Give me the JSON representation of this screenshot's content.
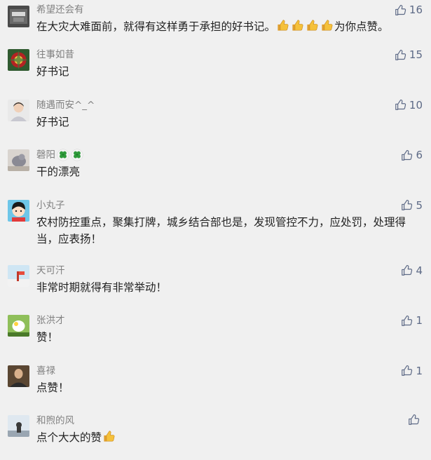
{
  "comments": [
    {
      "name": "希望还会有",
      "text": "在大灾大难面前，就得有这样勇于承担的好书记。",
      "text_suffix": "为你点赞。",
      "likes": "16",
      "thumbs": 4
    },
    {
      "name": "往事如昔",
      "text": "好书记",
      "likes": "15"
    },
    {
      "name": "随遇而安^_^",
      "text": "好书记",
      "likes": "10"
    },
    {
      "name": "磬阳",
      "text": "干的漂亮",
      "likes": "6"
    },
    {
      "name": "小丸子",
      "text": "农村防控重点，聚集打牌，城乡结合部也是，发现管控不力，应处罚，处理得当，应表扬！",
      "likes": "5"
    },
    {
      "name": "天可汗",
      "text": "非常时期就得有非常举动！",
      "likes": "4"
    },
    {
      "name": "张洪才",
      "text": "赞！",
      "likes": "1"
    },
    {
      "name": "喜禄",
      "text": "点赞！",
      "likes": "1"
    },
    {
      "name": "和煦的风",
      "text": "点个大大的赞",
      "likes": ""
    }
  ],
  "colors": {
    "background": "#f0f0f0",
    "nickname": "#808080",
    "text": "#222222",
    "like": "#5d6a86"
  },
  "icons": {
    "like": "thumbs-up-outline-icon",
    "emoji_thumb": "thumbs-up-emoji-icon",
    "clover": "four-leaf-clover-emoji-icon"
  }
}
